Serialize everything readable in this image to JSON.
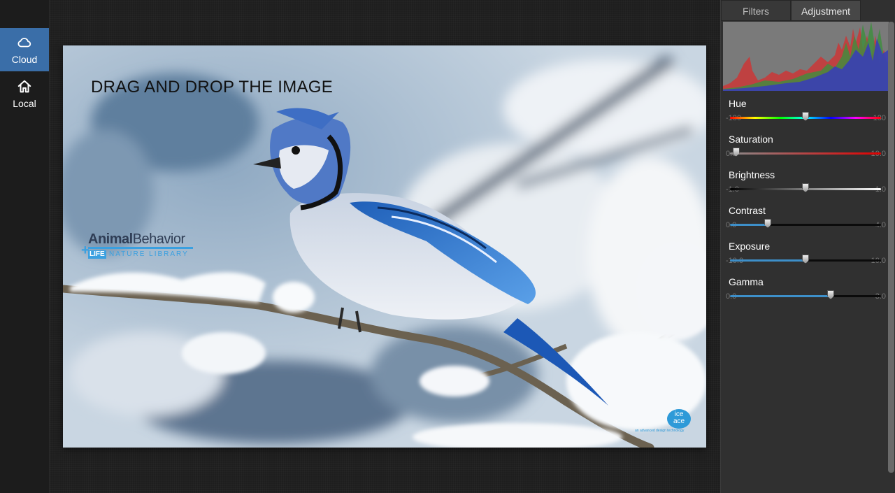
{
  "sidebar": {
    "items": [
      {
        "label": "Cloud",
        "icon": "cloud-icon",
        "active": true
      },
      {
        "label": "Local",
        "icon": "home-icon",
        "active": false
      }
    ]
  },
  "canvas": {
    "drop_text": "DRAG AND DROP THE IMAGE",
    "watermark": {
      "title_bold": "Animal",
      "title_light": "Behavior",
      "plus": "+",
      "life": "LIFE",
      "subtitle": "NATURE LIBRARY"
    },
    "corner_logo": {
      "line1": "ice",
      "line2": "ace",
      "tagline": "an advanced design technology"
    }
  },
  "panel": {
    "tabs": [
      {
        "label": "Filters",
        "active": false
      },
      {
        "label": "Adjustment",
        "active": true
      }
    ],
    "adjustments": [
      {
        "label": "Hue",
        "min": "-180",
        "max": "180",
        "value": 0,
        "track": "spectrum"
      },
      {
        "label": "Saturation",
        "min": "0.0",
        "max": "10.0",
        "value": 0.4,
        "track": "gray-to-red"
      },
      {
        "label": "Brightness",
        "min": "-1.0",
        "max": "1.0",
        "value": 0.0,
        "track": "black-to-white"
      },
      {
        "label": "Contrast",
        "min": "0.0",
        "max": "4.0",
        "value": 1.0,
        "track": "blue-fill"
      },
      {
        "label": "Exposure",
        "min": "-10.0",
        "max": "10.0",
        "value": 0.0,
        "track": "blue-fill"
      },
      {
        "label": "Gamma",
        "min": "0.0",
        "max": "3.0",
        "value": 2.0,
        "track": "blue-fill"
      }
    ],
    "colors": {
      "accent": "#3a6ea8",
      "fill_blue": "#3d8fc9"
    }
  }
}
